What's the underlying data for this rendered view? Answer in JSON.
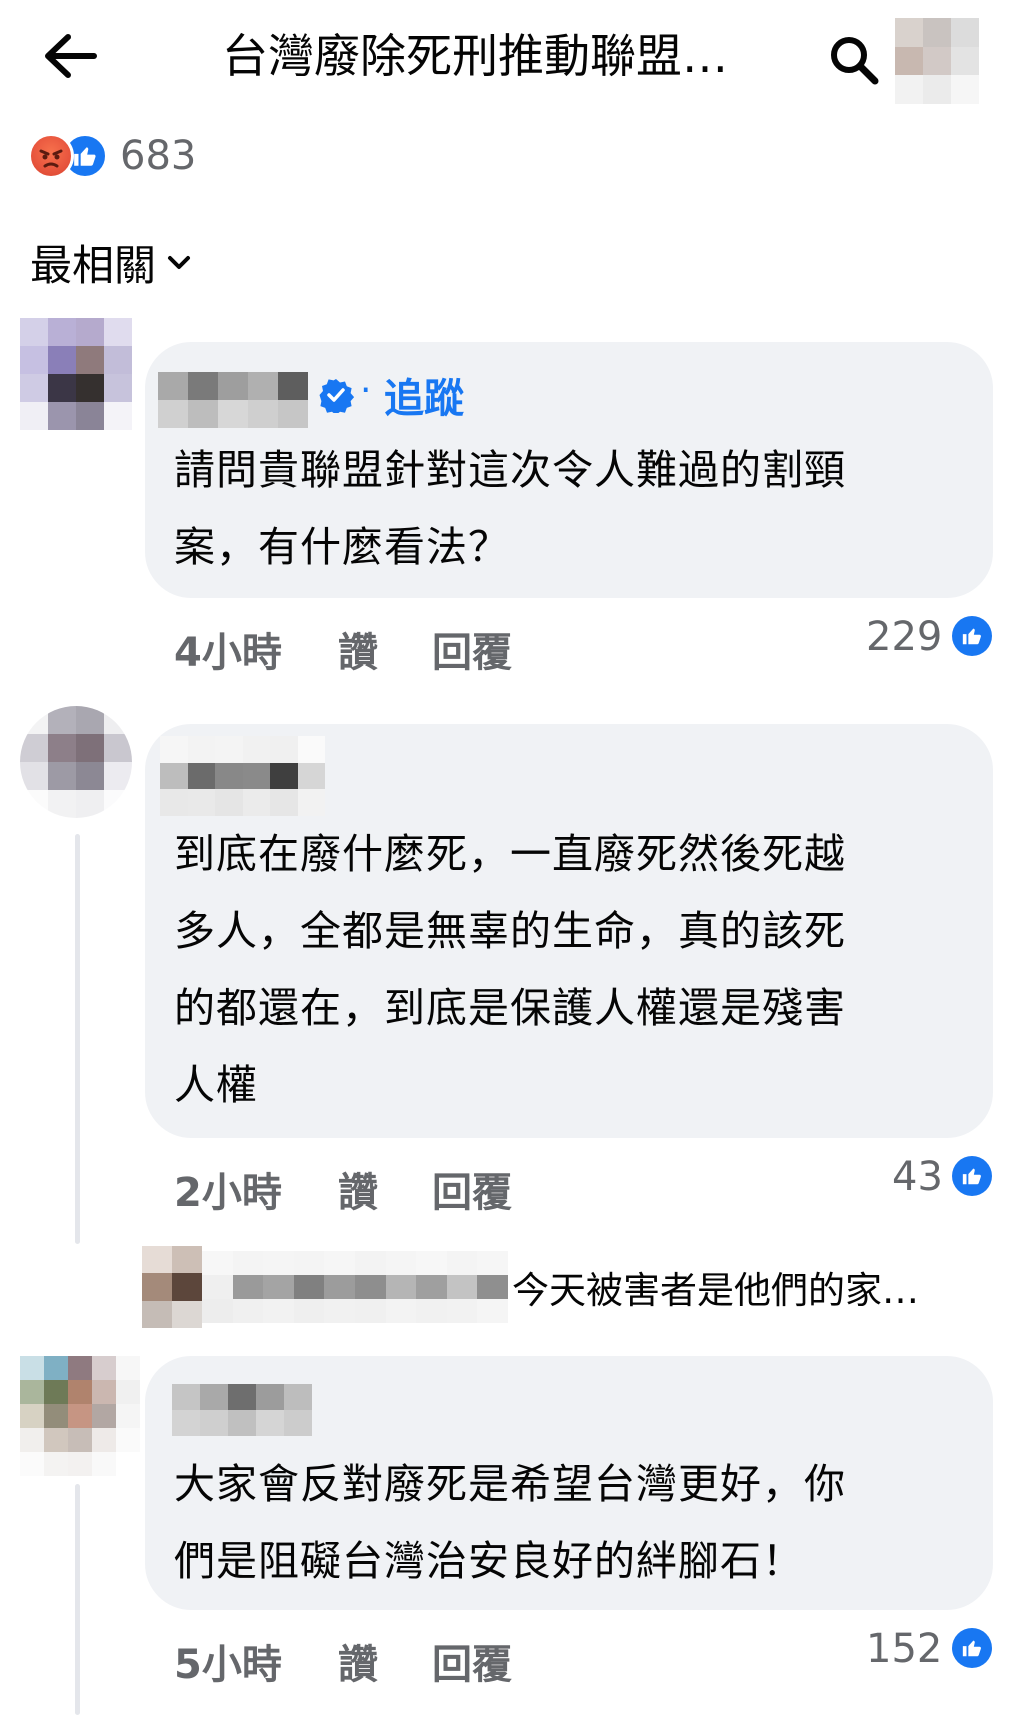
{
  "header": {
    "title": "台灣廢除死刑推動聯盟…",
    "back_icon": "arrow-left-icon",
    "search_icon": "search-icon"
  },
  "reactions": {
    "count": "683",
    "types": [
      "angry",
      "like"
    ]
  },
  "sort": {
    "label": "最相關"
  },
  "comments": [
    {
      "follow_label": "追蹤",
      "separator": "·",
      "verified": true,
      "lines": [
        "請問貴聯盟針對這次令人難過的割頸",
        "案，有什麼看法？"
      ],
      "time": "4小時",
      "like_label": "讚",
      "reply_label": "回覆",
      "like_count": "229"
    },
    {
      "lines": [
        "到底在廢什麼死，一直廢死然後死越",
        "多人，全都是無辜的生命，真的該死",
        "的都還在，到底是保護人權還是殘害",
        "人權"
      ],
      "time": "2小時",
      "like_label": "讚",
      "reply_label": "回覆",
      "like_count": "43",
      "reply_preview": "今天被害者是他們的家…"
    },
    {
      "lines": [
        "大家會反對廢死是希望台灣更好，你",
        "們是阻礙台灣治安良好的絆腳石！"
      ],
      "time": "5小時",
      "like_label": "讚",
      "reply_label": "回覆",
      "like_count": "152"
    }
  ],
  "colors": {
    "like_blue": "#1877f2",
    "secondary_text": "#65676b",
    "bubble_bg": "#f0f2f5"
  }
}
